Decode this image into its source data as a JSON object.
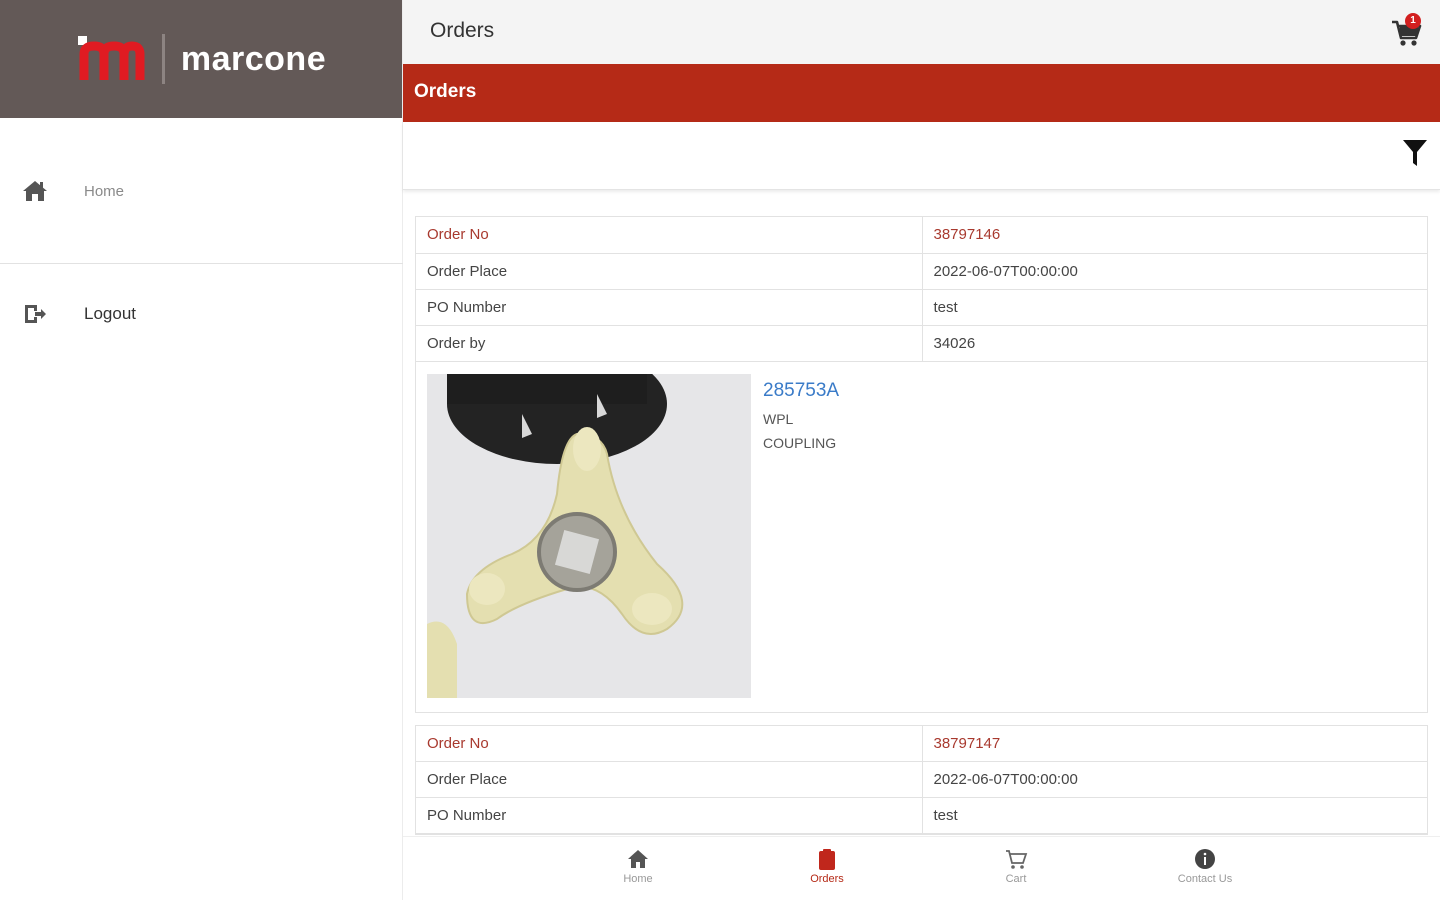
{
  "brand": {
    "name": "marcone"
  },
  "sidebar": {
    "items": [
      {
        "label": "Home",
        "icon": "home-icon"
      },
      {
        "label": "Logout",
        "icon": "logout-icon"
      }
    ]
  },
  "header": {
    "title": "Orders",
    "cart_count": "1"
  },
  "section": {
    "title": "Orders"
  },
  "orders": [
    {
      "rows": [
        {
          "label": "Order No",
          "value": "38797146"
        },
        {
          "label": "Order Place",
          "value": "2022-06-07T00:00:00"
        },
        {
          "label": "PO Number",
          "value": "test"
        },
        {
          "label": "Order by",
          "value": "34026"
        }
      ],
      "product": {
        "part_no": "285753A",
        "brand": "WPL",
        "description": "COUPLING"
      }
    },
    {
      "rows": [
        {
          "label": "Order No",
          "value": "38797147"
        },
        {
          "label": "Order Place",
          "value": "2022-06-07T00:00:00"
        },
        {
          "label": "PO Number",
          "value": "test"
        }
      ]
    }
  ],
  "tabs": [
    {
      "label": "Home",
      "icon": "home-icon"
    },
    {
      "label": "Orders",
      "icon": "clipboard-icon"
    },
    {
      "label": "Cart",
      "icon": "cart-icon"
    },
    {
      "label": "Contact Us",
      "icon": "info-icon"
    }
  ],
  "colors": {
    "accent": "#b52a17",
    "brand_bg": "#635957",
    "link": "#3a7bc8"
  }
}
